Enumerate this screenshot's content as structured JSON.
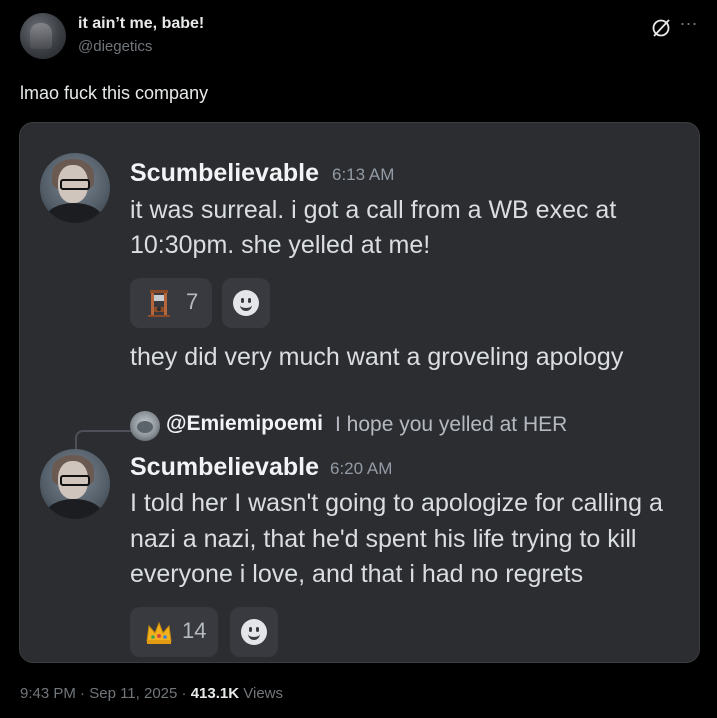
{
  "tweet": {
    "display_name": "it ain’t me, babe!",
    "handle": "@diegetics",
    "text": "lmao fuck this company",
    "more_icon": "more-icon",
    "grok_icon": "grok-icon",
    "timestamp": "9:43 PM",
    "separator": "·",
    "date": "Sep 11, 2025",
    "views_count": "413.1K",
    "views_label": "Views"
  },
  "discord": {
    "messages": [
      {
        "username": "Scumbelievable",
        "time": "6:13 AM",
        "lines": [
          "it was surreal. i got a call from a WB exec at",
          "10:30pm. she yelled at me!"
        ],
        "reaction": {
          "emoji": "guillotine",
          "count": "7"
        },
        "followup": "they did very much want a groveling apology"
      },
      {
        "reply_to": {
          "name": "@Emiemipoemi",
          "text": "I hope you yelled at HER"
        },
        "username": "Scumbelievable",
        "time": "6:20 AM",
        "lines": [
          "I told her I wasn't going to apologize for calling a",
          "nazi a nazi, that he'd spent his life trying to kill",
          "everyone i love, and that i had no regrets"
        ],
        "reaction": {
          "emoji": "crown",
          "count": "14"
        }
      }
    ]
  },
  "colors": {
    "background": "#000000",
    "discord_bg": "#2b2d31",
    "text_primary": "#e7e9ea",
    "text_muted": "#71767b"
  }
}
